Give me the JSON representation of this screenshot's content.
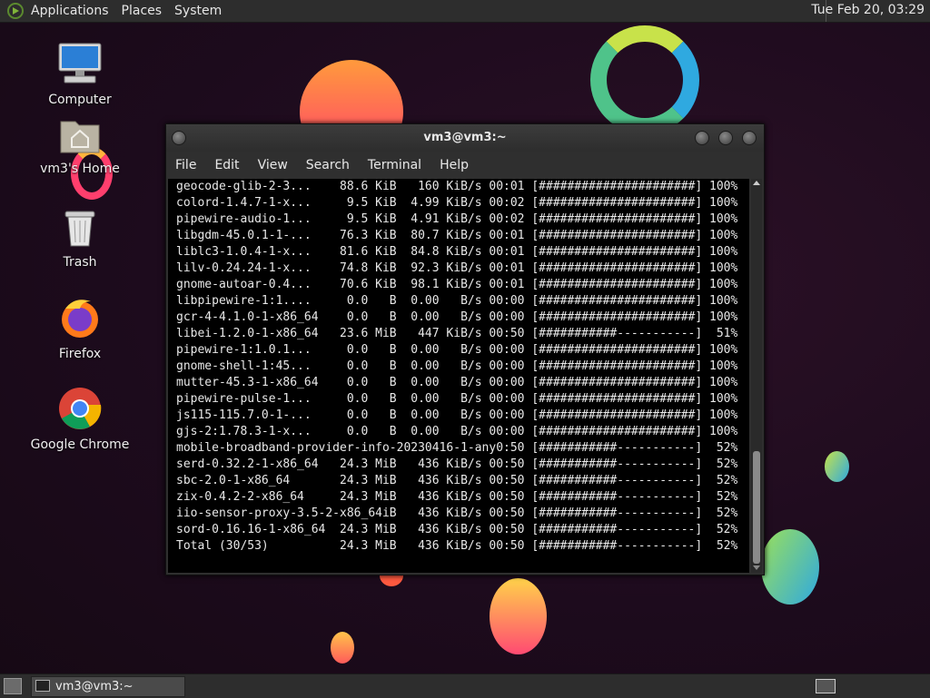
{
  "top_panel": {
    "menus": [
      "Applications",
      "Places",
      "System"
    ],
    "clock": "Tue Feb 20, 03:29"
  },
  "desktop": {
    "icons": [
      {
        "label": "Computer",
        "icon": "computer-icon"
      },
      {
        "label": "vm3's Home",
        "icon": "home-folder-icon"
      },
      {
        "label": "Trash",
        "icon": "trash-icon"
      },
      {
        "label": "Firefox",
        "icon": "firefox-icon"
      },
      {
        "label": "Google Chrome",
        "icon": "chrome-icon"
      }
    ]
  },
  "terminal": {
    "title": "vm3@vm3:~",
    "menu": [
      "File",
      "Edit",
      "View",
      "Search",
      "Terminal",
      "Help"
    ],
    "lines": [
      "geocode-glib-2-3...    88.6 KiB   160 KiB/s 00:01 [######################] 100%",
      "colord-1.4.7-1-x...     9.5 KiB  4.99 KiB/s 00:02 [######################] 100%",
      "pipewire-audio-1...     9.5 KiB  4.91 KiB/s 00:02 [######################] 100%",
      "libgdm-45.0.1-1-...    76.3 KiB  80.7 KiB/s 00:01 [######################] 100%",
      "liblc3-1.0.4-1-x...    81.6 KiB  84.8 KiB/s 00:01 [######################] 100%",
      "lilv-0.24.24-1-x...    74.8 KiB  92.3 KiB/s 00:01 [######################] 100%",
      "gnome-autoar-0.4...    70.6 KiB  98.1 KiB/s 00:01 [######################] 100%",
      "libpipewire-1:1....     0.0   B  0.00   B/s 00:00 [######################] 100%",
      "gcr-4-4.1.0-1-x86_64    0.0   B  0.00   B/s 00:00 [######################] 100%",
      "libei-1.2.0-1-x86_64   23.6 MiB   447 KiB/s 00:50 [###########-----------]  51%",
      "pipewire-1:1.0.1...     0.0   B  0.00   B/s 00:00 [######################] 100%",
      "gnome-shell-1:45...     0.0   B  0.00   B/s 00:00 [######################] 100%",
      "mutter-45.3-1-x86_64    0.0   B  0.00   B/s 00:00 [######################] 100%",
      "pipewire-pulse-1...     0.0   B  0.00   B/s 00:00 [######################] 100%",
      "js115-115.7.0-1-...     0.0   B  0.00   B/s 00:00 [######################] 100%",
      "gjs-2:1.78.3-1-x...     0.0   B  0.00   B/s 00:00 [######################] 100%",
      "mobile-broadband-provider-info-20230416-1-any0:50 [###########-----------]  52%",
      "serd-0.32.2-1-x86_64   24.3 MiB   436 KiB/s 00:50 [###########-----------]  52%",
      "sbc-2.0-1-x86_64       24.3 MiB   436 KiB/s 00:50 [###########-----------]  52%",
      "zix-0.4.2-2-x86_64     24.3 MiB   436 KiB/s 00:50 [###########-----------]  52%",
      "iio-sensor-proxy-3.5-2-x86_64iB   436 KiB/s 00:50 [###########-----------]  52%",
      "sord-0.16.16-1-x86_64  24.3 MiB   436 KiB/s 00:50 [###########-----------]  52%",
      "Total (30/53)          24.3 MiB   436 KiB/s 00:50 [###########-----------]  52%"
    ]
  },
  "taskbar": {
    "items": [
      {
        "label": "vm3@vm3:~"
      }
    ]
  }
}
